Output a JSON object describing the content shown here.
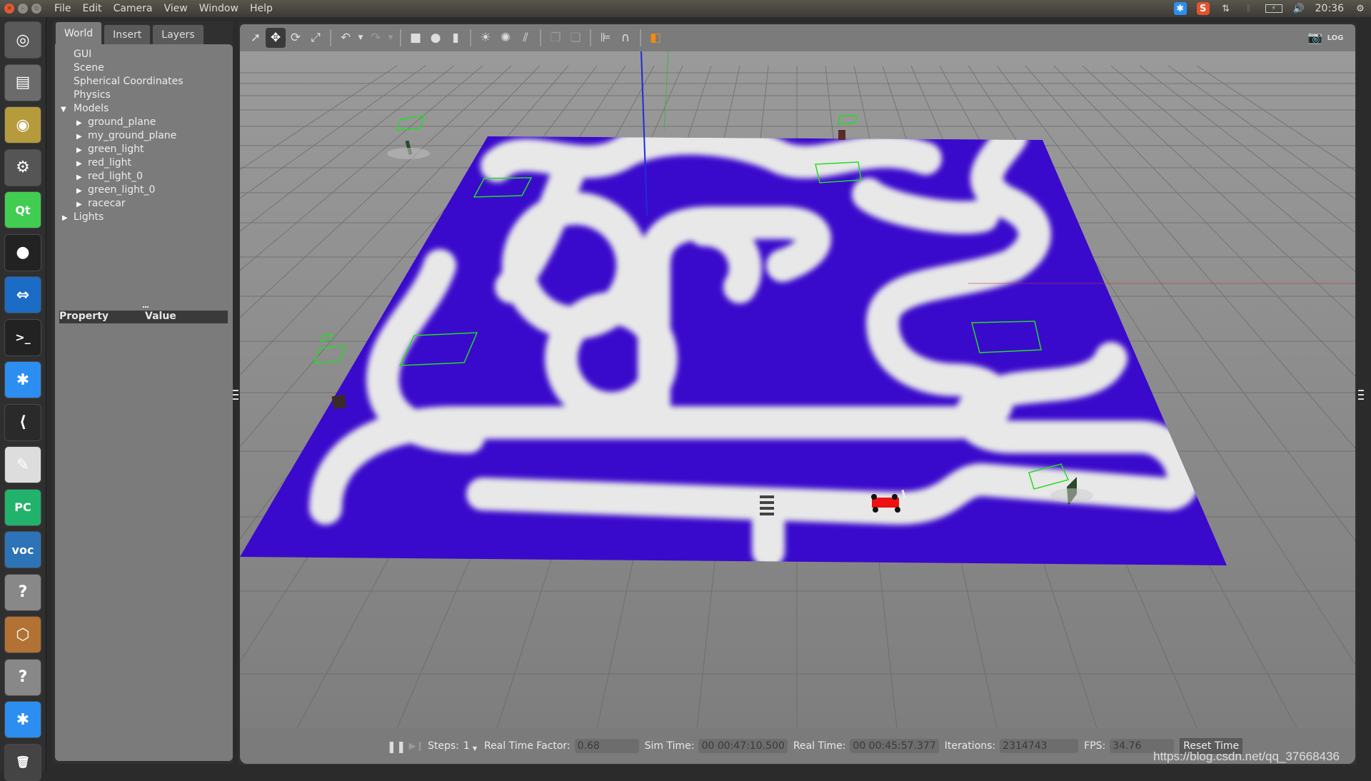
{
  "topbar": {
    "menus": [
      "File",
      "Edit",
      "Camera",
      "View",
      "Window",
      "Help"
    ],
    "window_buttons": {
      "close": "×",
      "minimize": "–",
      "maximize": "▫"
    },
    "tray": {
      "time": "20:36",
      "icons": [
        "sogou-keyboard-icon",
        "sogou-input-icon",
        "network-icon",
        "bluetooth-icon",
        "battery-icon",
        "volume-icon",
        "power-icon"
      ]
    }
  },
  "launcher": {
    "items": [
      {
        "name": "ubuntu-dash",
        "glyph": "◎",
        "color": "#5a5a5a"
      },
      {
        "name": "files",
        "glyph": "▤",
        "color": "#6b6b6b"
      },
      {
        "name": "chrome",
        "glyph": "◉",
        "color": "#b59b3c"
      },
      {
        "name": "system-settings",
        "glyph": "⚙",
        "color": "#555"
      },
      {
        "name": "qt-creator",
        "glyph": "Qt",
        "color": "#41cd52"
      },
      {
        "name": "camera",
        "glyph": "●",
        "color": "#222"
      },
      {
        "name": "teamviewer",
        "glyph": "⇔",
        "color": "#1a6cc4"
      },
      {
        "name": "terminal",
        "glyph": ">_",
        "color": "#222"
      },
      {
        "name": "sogou",
        "glyph": "✱",
        "color": "#2b8ef0"
      },
      {
        "name": "vscode",
        "glyph": "⟨",
        "color": "#2a2a2a"
      },
      {
        "name": "text-editor",
        "glyph": "✎",
        "color": "#ddd"
      },
      {
        "name": "pycharm",
        "glyph": "PC",
        "color": "#21b36b"
      },
      {
        "name": "voc",
        "glyph": "voc",
        "color": "#2d73b8"
      },
      {
        "name": "unknown-app",
        "glyph": "?",
        "color": "#888"
      },
      {
        "name": "gazebo",
        "glyph": "⬡",
        "color": "#b27234"
      },
      {
        "name": "unknown-app-2",
        "glyph": "?",
        "color": "#888"
      },
      {
        "name": "sogou-2",
        "glyph": "✱",
        "color": "#2b8ef0"
      },
      {
        "name": "trash",
        "glyph": "🗑",
        "color": "#444"
      }
    ]
  },
  "left_panel": {
    "tabs": [
      "World",
      "Insert",
      "Layers"
    ],
    "active_tab": "World",
    "tree": {
      "top": [
        "GUI",
        "Scene",
        "Spherical Coordinates",
        "Physics"
      ],
      "models_label": "Models",
      "models": [
        "ground_plane",
        "my_ground_plane",
        "green_light",
        "red_light",
        "red_light_0",
        "green_light_0",
        "racecar"
      ],
      "lights_label": "Lights"
    },
    "property_header": {
      "property": "Property",
      "value": "Value"
    }
  },
  "toolbar": {
    "tools": [
      "select-arrow",
      "translate",
      "rotate",
      "scale",
      "undo",
      "undo-dropdown",
      "redo",
      "redo-dropdown",
      "box",
      "sphere",
      "cylinder",
      "point-light",
      "spot-light",
      "directional-light",
      "copy",
      "paste",
      "align",
      "snap",
      "view-angle"
    ],
    "right": [
      "screenshot",
      "log"
    ]
  },
  "bottombar": {
    "steps_label": "Steps:",
    "steps_value": "1",
    "rtf_label": "Real Time Factor:",
    "rtf_value": "0.68",
    "sim_label": "Sim Time:",
    "sim_value": "00 00:47:10.500",
    "real_label": "Real Time:",
    "real_value": "00 00:45:57.377",
    "iter_label": "Iterations:",
    "iter_value": "2314743",
    "fps_label": "FPS:",
    "fps_value": "34.76",
    "reset_label": "Reset Time"
  },
  "watermark": "https://blog.csdn.net/qq_37668436",
  "colors": {
    "track_bg": "#3a0acc",
    "track_line": "#e8e8e8",
    "sensor": "#22dd22",
    "car": "#ee1111"
  }
}
